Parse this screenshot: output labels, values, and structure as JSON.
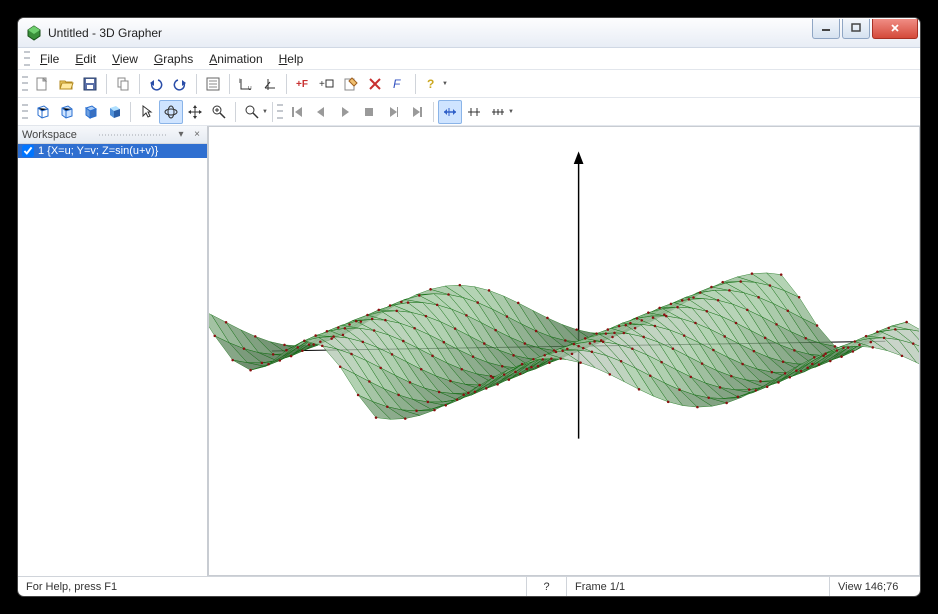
{
  "window": {
    "title": "Untitled - 3D Grapher"
  },
  "menubar": {
    "file": "File",
    "edit": "Edit",
    "view": "View",
    "graphs": "Graphs",
    "animation": "Animation",
    "help": "Help"
  },
  "workspace": {
    "title": "Workspace",
    "items": [
      {
        "checked": true,
        "label": "1 {X=u; Y=v; Z=sin(u+v)}"
      }
    ]
  },
  "statusbar": {
    "help": "For Help, press F1",
    "q": "?",
    "frame": "Frame 1/1",
    "view": "View 146;76"
  },
  "icons": {
    "new": "new",
    "open": "open",
    "save": "save",
    "copy": "copy",
    "undo": "undo",
    "redo": "redo",
    "props": "props",
    "axes1": "axes1",
    "axes2": "axes2",
    "addf": "addf",
    "addbox": "addbox",
    "editf": "editf",
    "delf": "delf",
    "italf": "italf",
    "helpq": "helpq",
    "cube1": "cube1",
    "cube2": "cube2",
    "cube3": "cube3",
    "cube4": "cube4",
    "cursor": "cursor",
    "rotate": "rotate",
    "pan": "pan",
    "fit": "fit",
    "zoom": "zoom",
    "first": "first",
    "prev": "prev",
    "play": "play",
    "stop": "stop",
    "next2": "next2",
    "last": "last",
    "snap1": "snap1",
    "snap2": "snap2",
    "snap3": "snap3"
  }
}
